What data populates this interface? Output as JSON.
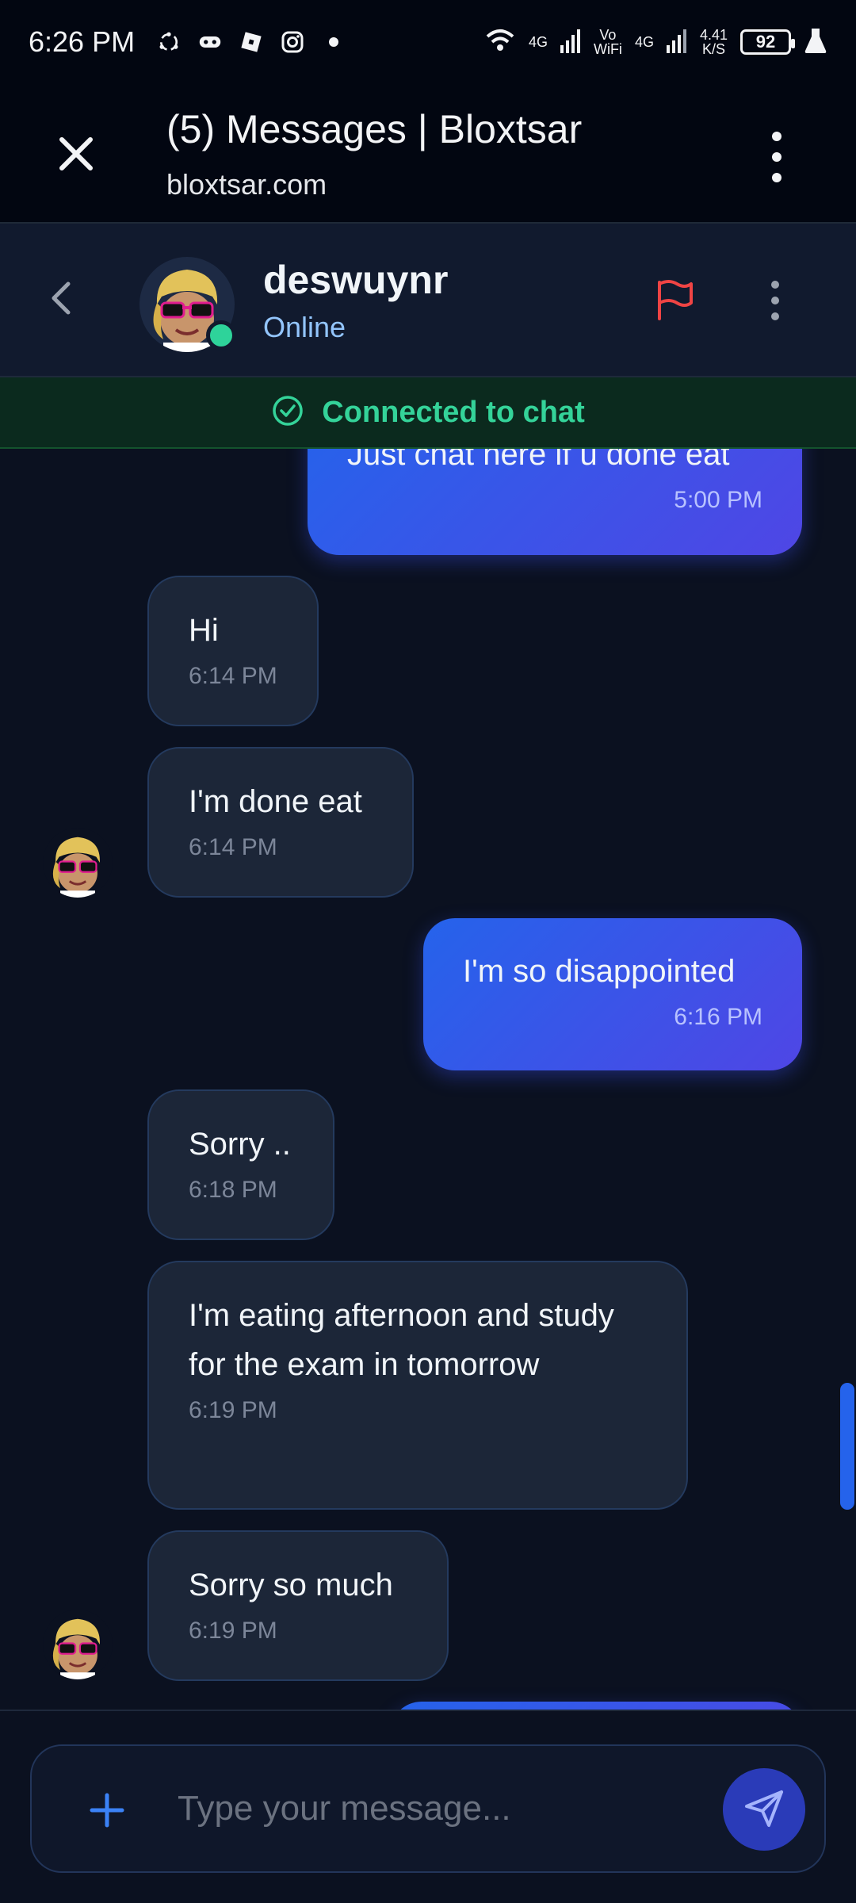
{
  "status_bar": {
    "time": "6:26 PM",
    "left_icons": [
      "hotspot-sync-icon",
      "gamepad-icon",
      "roblox-icon",
      "instagram-icon",
      "dot-icon"
    ],
    "network_1": "4G",
    "volte_top": "Vo",
    "volte_bottom": "WiFi",
    "network_2": "4G",
    "speed_value": "4.41",
    "speed_unit": "K/S",
    "battery": "92"
  },
  "browser": {
    "title": "(5) Messages | Bloxtsar",
    "url": "bloxtsar.com"
  },
  "chat_header": {
    "username": "deswuynr",
    "status": "Online",
    "flag_color": "#ef4444",
    "online_color": "#2ed39a"
  },
  "banner": {
    "text": "Connected to chat",
    "color": "#34d399"
  },
  "messages": [
    {
      "direction": "out",
      "text": "Just chat here if u done eat",
      "time": "5:00 PM"
    },
    {
      "direction": "in",
      "text": "Hi",
      "time": "6:14 PM"
    },
    {
      "direction": "in",
      "text": "I'm done eat",
      "time": "6:14 PM"
    },
    {
      "direction": "out",
      "text": "I'm so disappointed",
      "time": "6:16 PM"
    },
    {
      "direction": "in",
      "text": "Sorry ..",
      "time": "6:18 PM"
    },
    {
      "direction": "in",
      "text": "I'm eating afternoon and study for the exam in tomorrow",
      "time": "6:19 PM"
    },
    {
      "direction": "in",
      "text": "Sorry so much",
      "time": "6:19 PM"
    }
  ],
  "composer": {
    "placeholder": "Type your message..."
  }
}
